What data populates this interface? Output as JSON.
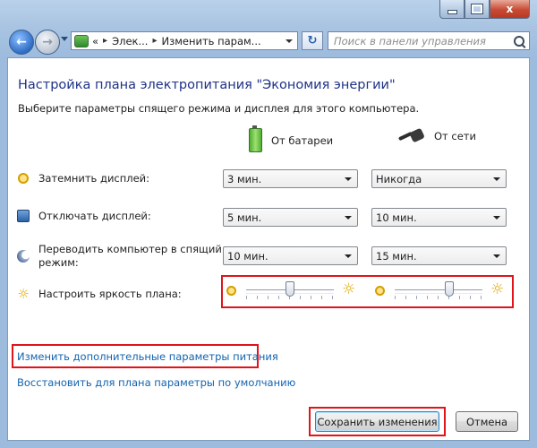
{
  "window": {
    "close_glyph": "x"
  },
  "navbar": {
    "back_glyph": "←",
    "forward_glyph": "→",
    "breadcrumb_root_arrow": "«",
    "breadcrumb_parent": "Элек...",
    "breadcrumb_current": "Изменить парам...",
    "breadcrumb_sep": "▸",
    "refresh_glyph": "↻",
    "search_placeholder": "Поиск в панели управления"
  },
  "page": {
    "title": "Настройка плана электропитания \"Экономия энергии\"",
    "subtitle": "Выберите параметры спящего режима и дисплея для этого компьютера."
  },
  "columns": {
    "battery": "От батареи",
    "ac": "От сети"
  },
  "rows": [
    {
      "label": "Затемнить дисплей:",
      "battery": "3 мин.",
      "ac": "Никогда"
    },
    {
      "label": "Отключать дисплей:",
      "battery": "5 мин.",
      "ac": "10 мин."
    },
    {
      "label_line1": "Переводить компьютер в спящий",
      "label_line2": "режим:",
      "battery": "10 мин.",
      "ac": "15 мин."
    },
    {
      "label": "Настроить яркость плана:"
    }
  ],
  "brightness": {
    "battery_level": 0.5,
    "ac_level": 0.62,
    "bright_glyph": "☼"
  },
  "links": {
    "advanced": "Изменить дополнительные параметры питания",
    "restore": "Восстановить для плана параметры по умолчанию"
  },
  "buttons": {
    "save": "Сохранить изменения",
    "cancel": "Отмена"
  },
  "colors": {
    "title": "#1e3287",
    "link": "#1163b0",
    "highlight": "#e0141a"
  }
}
